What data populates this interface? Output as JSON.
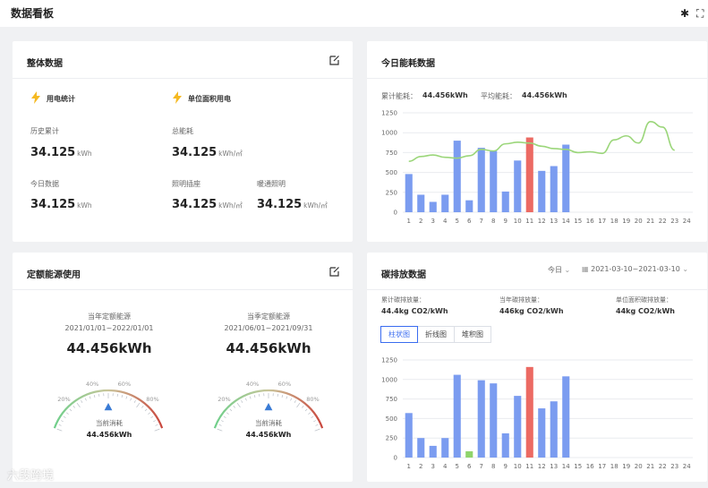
{
  "app": {
    "title": "数据看板"
  },
  "overall": {
    "title": "整体数据",
    "section1": "用电统计",
    "section2": "单位面积用电",
    "hist_label": "历史累计",
    "hist_value": "34.125",
    "hist_unit": "kWh",
    "total_label": "总能耗",
    "total_value": "34.125",
    "total_unit": "kWh/㎡",
    "today_label": "今日数据",
    "today_value": "34.125",
    "today_unit": "kWh",
    "light_label": "照明插座",
    "light_value": "34.125",
    "light_unit": "kWh/㎡",
    "hvac_label": "暖通照明",
    "hvac_value": "34.125",
    "hvac_unit": "kWh/㎡"
  },
  "today_energy": {
    "title": "今日能耗数据",
    "total_label": "累计能耗：",
    "total_value": "44.456kWh",
    "avg_label": "平均能耗：",
    "avg_value": "44.456kWh"
  },
  "quota": {
    "title": "定额能源使用",
    "left": {
      "title": "当年定额能源",
      "range": "2021/01/01~2022/01/01",
      "value": "44.456kWh",
      "gauge_center_label": "当前消耗",
      "gauge_center_value": "44.456kWh",
      "level_percent": 50
    },
    "right": {
      "title": "当季定额能源",
      "range": "2021/06/01~2021/09/31",
      "value": "44.456kWh",
      "gauge_center_label": "当前消耗",
      "gauge_center_value": "44.456kWh",
      "level_percent": 50
    },
    "gauge_ticks": [
      "20%",
      "40%",
      "60%",
      "80%"
    ]
  },
  "carbon": {
    "title": "碳排放数据",
    "period": "今日",
    "date_range": "2021-03-10~2021-03-10",
    "total_label": "累计碳排放量：",
    "total_value": "44.4kg CO2/kWh",
    "year_label": "当年碳排放量：",
    "year_value": "446kg CO2/kWh",
    "unit_label": "单位面积碳排放量：",
    "unit_value": "44kg CO2/kWh",
    "tabs": [
      "柱状图",
      "折线图",
      "堆积图"
    ]
  },
  "watermark": "六段跨境",
  "colors": {
    "bar": "#7b9cf0",
    "bar_highlight": "#ec6a63",
    "bar_low": "#8fd46b",
    "line": "#9bd67a",
    "accent": "#3a6cf0",
    "grid": "#e9ebef",
    "gauge_green": "#6fcf8b",
    "gauge_red": "#c9463d",
    "pointer": "#3a7bd5",
    "icon_bolt": "#f5b921"
  },
  "chart_data": [
    {
      "type": "bar",
      "name": "today-energy",
      "categories": [
        "1",
        "2",
        "3",
        "4",
        "5",
        "6",
        "7",
        "8",
        "9",
        "10",
        "11",
        "12",
        "13",
        "14",
        "15",
        "16",
        "17",
        "18",
        "19",
        "20",
        "21",
        "22",
        "23",
        "24"
      ],
      "values": [
        480,
        220,
        130,
        220,
        900,
        150,
        810,
        770,
        260,
        650,
        940,
        520,
        580,
        850,
        null,
        null,
        null,
        null,
        null,
        null,
        null,
        null,
        null,
        null
      ],
      "highlight_index": 10,
      "line_values": [
        640,
        700,
        720,
        690,
        680,
        710,
        790,
        770,
        860,
        880,
        870,
        830,
        800,
        790,
        750,
        760,
        740,
        910,
        960,
        870,
        1140,
        1070,
        780
      ],
      "ylim": [
        0,
        1250
      ],
      "yticks": [
        0,
        250,
        500,
        750,
        1000,
        1250
      ],
      "grid": true
    },
    {
      "type": "bar",
      "name": "carbon-emission",
      "categories": [
        "1",
        "2",
        "3",
        "4",
        "5",
        "6",
        "7",
        "8",
        "9",
        "10",
        "11",
        "12",
        "13",
        "14",
        "15",
        "16",
        "17",
        "18",
        "19",
        "20",
        "21",
        "22",
        "23",
        "24"
      ],
      "values": [
        570,
        250,
        150,
        250,
        1060,
        80,
        990,
        950,
        310,
        790,
        1160,
        630,
        720,
        1040,
        null,
        null,
        null,
        null,
        null,
        null,
        null,
        null,
        null,
        null
      ],
      "highlight_index": 10,
      "low_index": 5,
      "ylim": [
        0,
        1250
      ],
      "yticks": [
        0,
        250,
        500,
        750,
        1000,
        1250
      ],
      "grid": true
    }
  ]
}
